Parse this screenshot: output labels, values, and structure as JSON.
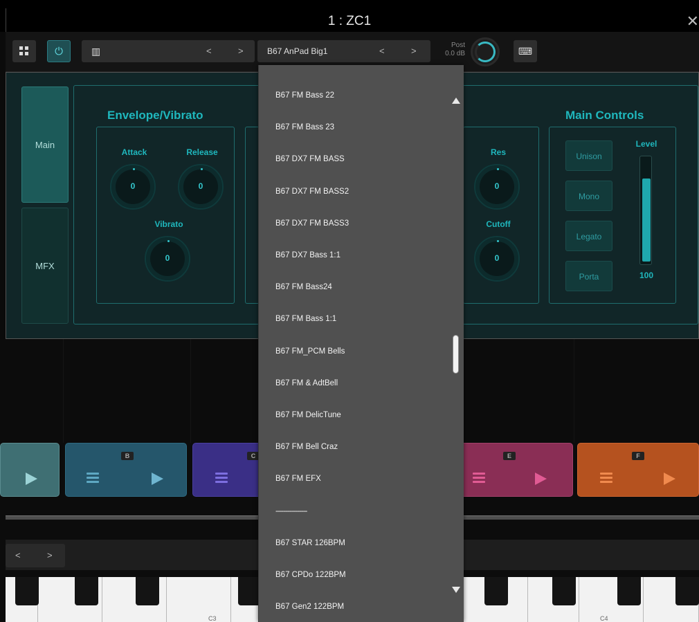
{
  "window": {
    "title": "1 : ZC1",
    "close_glyph": "✕"
  },
  "toolbar": {
    "grid_icon": "grid-icon",
    "power_icon": "power-icon",
    "power_glyph": "⏻",
    "rack_icon": "rack-icon",
    "rack_glyph": "▥",
    "prev_glyph": "<",
    "next_glyph": ">",
    "preset_name": "B67 AnPad Big1",
    "post_label": "Post",
    "post_value": "0.0 dB",
    "keyboard_glyph": "⌨"
  },
  "side_tabs": {
    "main": "Main",
    "mfx": "MFX"
  },
  "envelope": {
    "title": "Envelope/Vibrato",
    "attack_label": "Attack",
    "attack_value": "0",
    "release_label": "Release",
    "release_value": "0",
    "vibrato_label": "Vibrato",
    "vibrato_value": "0"
  },
  "filter": {
    "res_label": "Res",
    "res_value": "0",
    "cutoff_label": "Cutoff",
    "cutoff_value": "0"
  },
  "main_controls": {
    "title": "Main Controls",
    "unison": "Unison",
    "mono": "Mono",
    "legato": "Legato",
    "porta": "Porta",
    "level_label": "Level",
    "level_value": "100",
    "level_fraction": 0.8
  },
  "pads": {
    "b": "B",
    "c": "C",
    "e": "E",
    "f": "F"
  },
  "keyboard": {
    "c3": "C3",
    "c4": "C4",
    "oct_prev": "<",
    "oct_next": ">"
  },
  "dropdown": {
    "items": [
      "B67 FM Bass 22",
      "B67 FM Bass 23",
      "B67 DX7 FM BASS",
      "B67 DX7 FM BASS2",
      "B67 DX7 FM BASS3",
      "B67 DX7 Bass 1:1",
      "B67 FM Bass24",
      "B67 FM Bass 1:1",
      "B67 FM_PCM Bells",
      "B67 FM & AdtBell",
      "B67 FM DelicTune",
      "B67 FM Bell Craz",
      "B67 FM EFX",
      "----------------",
      "B67 STAR 126BPM",
      "B67 CPDo 122BPM",
      "B67 Gen2 122BPM"
    ]
  },
  "colors": {
    "accent": "#1fb7bd",
    "pad_a": "#3f6f73",
    "pad_b": "#25566b",
    "pad_c": "#3a2f86",
    "pad_e": "#8a2e55",
    "pad_f": "#b5521f"
  }
}
